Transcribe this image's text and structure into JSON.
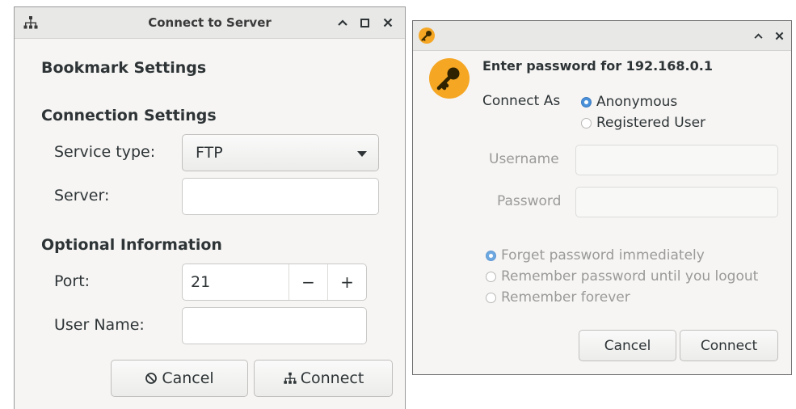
{
  "connect_server": {
    "title": "Connect to Server",
    "bookmark_settings": "Bookmark Settings",
    "connection_settings": "Connection Settings",
    "service_type_label": "Service type:",
    "service_type_value": "FTP",
    "server_label": "Server:",
    "server_value": "",
    "optional_information": "Optional Information",
    "port_label": "Port:",
    "port_value": "21",
    "port_minus": "−",
    "port_plus": "+",
    "user_name_label": "User Name:",
    "user_name_value": "",
    "cancel_label": "Cancel",
    "connect_label": "Connect"
  },
  "password_dialog": {
    "heading": "Enter password for 192.168.0.1",
    "connect_as_label": "Connect As",
    "anonymous": "Anonymous",
    "registered_user": "Registered User",
    "username_label": "Username",
    "password_label": "Password",
    "forget_immediately": "Forget password immediately",
    "remember_until_logout": "Remember password until you logout",
    "remember_forever": "Remember forever",
    "cancel_label": "Cancel",
    "connect_label": "Connect"
  },
  "icons": {
    "network": "network-icon",
    "key": "key-icon",
    "cancel": "cancel-icon",
    "connect": "network-icon"
  },
  "colors": {
    "accent": "#4a90d9",
    "key_badge": "#f5a623"
  }
}
